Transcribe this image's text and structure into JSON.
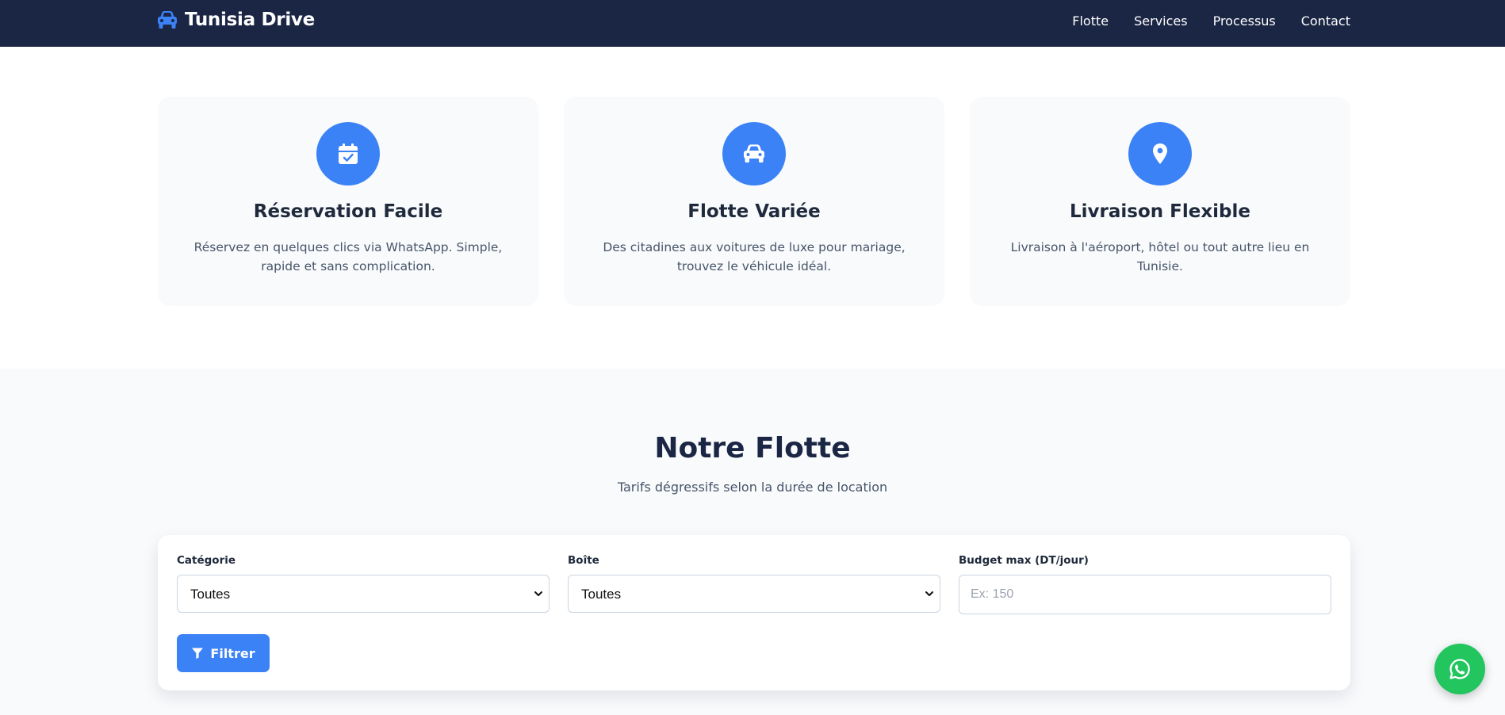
{
  "header": {
    "brand": "Tunisia Drive",
    "brand_icon": "car-icon",
    "nav": [
      {
        "label": "Flotte"
      },
      {
        "label": "Services"
      },
      {
        "label": "Processus"
      },
      {
        "label": "Contact"
      }
    ]
  },
  "features": [
    {
      "icon": "calendar-check-icon",
      "title": "Réservation Facile",
      "text": "Réservez en quelques clics via WhatsApp. Simple, rapide et sans complication."
    },
    {
      "icon": "car-icon",
      "title": "Flotte Variée",
      "text": "Des citadines aux voitures de luxe pour mariage, trouvez le véhicule idéal."
    },
    {
      "icon": "map-pin-icon",
      "title": "Livraison Flexible",
      "text": "Livraison à l'aéroport, hôtel ou tout autre lieu en Tunisie."
    }
  ],
  "fleet": {
    "title": "Notre Flotte",
    "subtitle": "Tarifs dégressifs selon la durée de location",
    "filters": {
      "category": {
        "label": "Catégorie",
        "value": "Toutes"
      },
      "gearbox": {
        "label": "Boîte",
        "value": "Toutes"
      },
      "budget": {
        "label": "Budget max (DT/jour)",
        "placeholder": "Ex: 150",
        "value": ""
      },
      "button_label": "Filtrer",
      "button_icon": "filter-icon"
    }
  },
  "floating": {
    "icon": "whatsapp-icon"
  },
  "colors": {
    "navbar": "#1b2644",
    "accent": "#3b82f6",
    "card_bg": "#f8fafc",
    "whatsapp": "#22c55e"
  }
}
